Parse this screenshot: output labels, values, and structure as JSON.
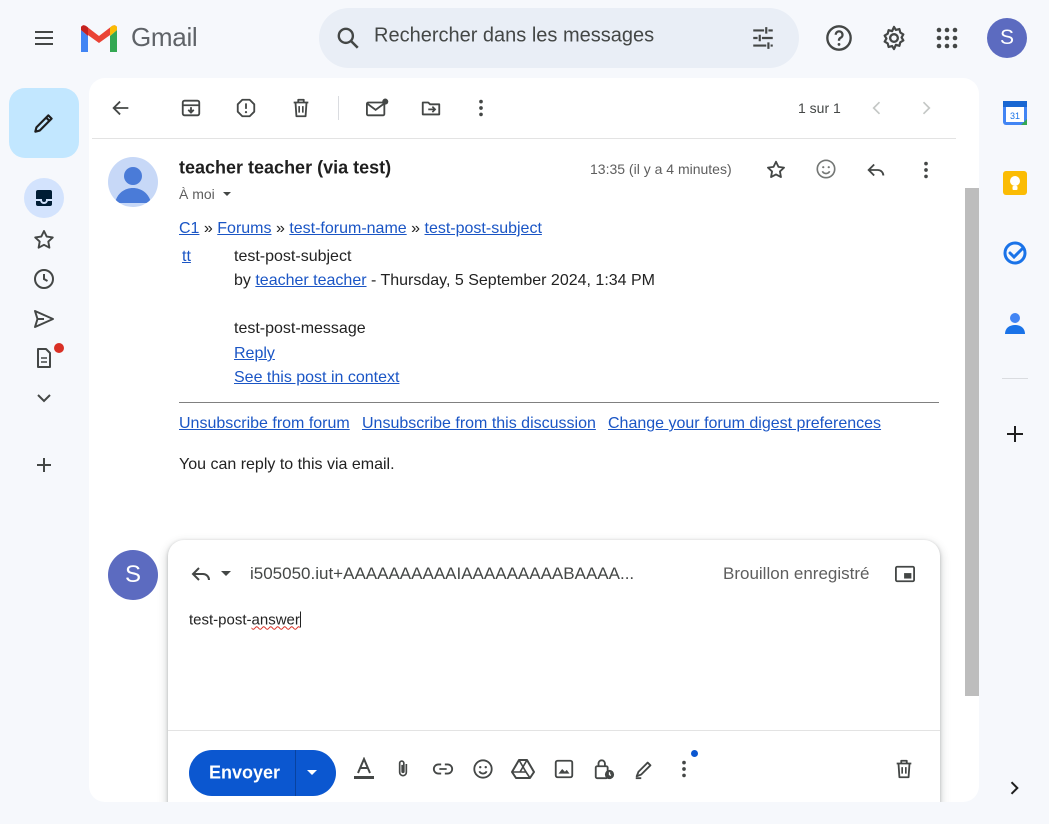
{
  "app": {
    "name": "Gmail"
  },
  "search": {
    "placeholder": "Rechercher dans les messages"
  },
  "account": {
    "initial": "S"
  },
  "toolbar": {
    "pager": "1 sur 1"
  },
  "message": {
    "sender": "teacher teacher (via test)",
    "recipient": "À moi",
    "time": "13:35 (il y a 4 minutes)",
    "breadcrumb": {
      "course": "C1",
      "sep": "»",
      "forums": "Forums",
      "forum": "test-forum-name",
      "post": "test-post-subject"
    },
    "author_link": "tt",
    "subject": "test-post-subject",
    "by_prefix": "by",
    "author": "teacher teacher",
    "date": " - Thursday, 5 September 2024, 1:34 PM",
    "content": "test-post-message",
    "reply_link": "Reply",
    "context_link": "See this post in context",
    "unsubscribe_forum": "Unsubscribe from forum",
    "unsubscribe_discussion": "Unsubscribe from this discussion",
    "digest_prefs": "Change your forum digest preferences",
    "footer_note": "You can reply to this via email."
  },
  "reply": {
    "avatar_initial": "S",
    "to": "i505050.iut+AAAAAAAAAAIAAAAAAAAABAAAA...",
    "status": "Brouillon enregistré",
    "text_a": "test-post-",
    "text_b": "answer",
    "send_label": "Envoyer"
  },
  "colors": {
    "accent": "#0b57d0",
    "compose_bg": "#c2e7ff",
    "link": "#1a55c5",
    "badge": "#d93025"
  }
}
